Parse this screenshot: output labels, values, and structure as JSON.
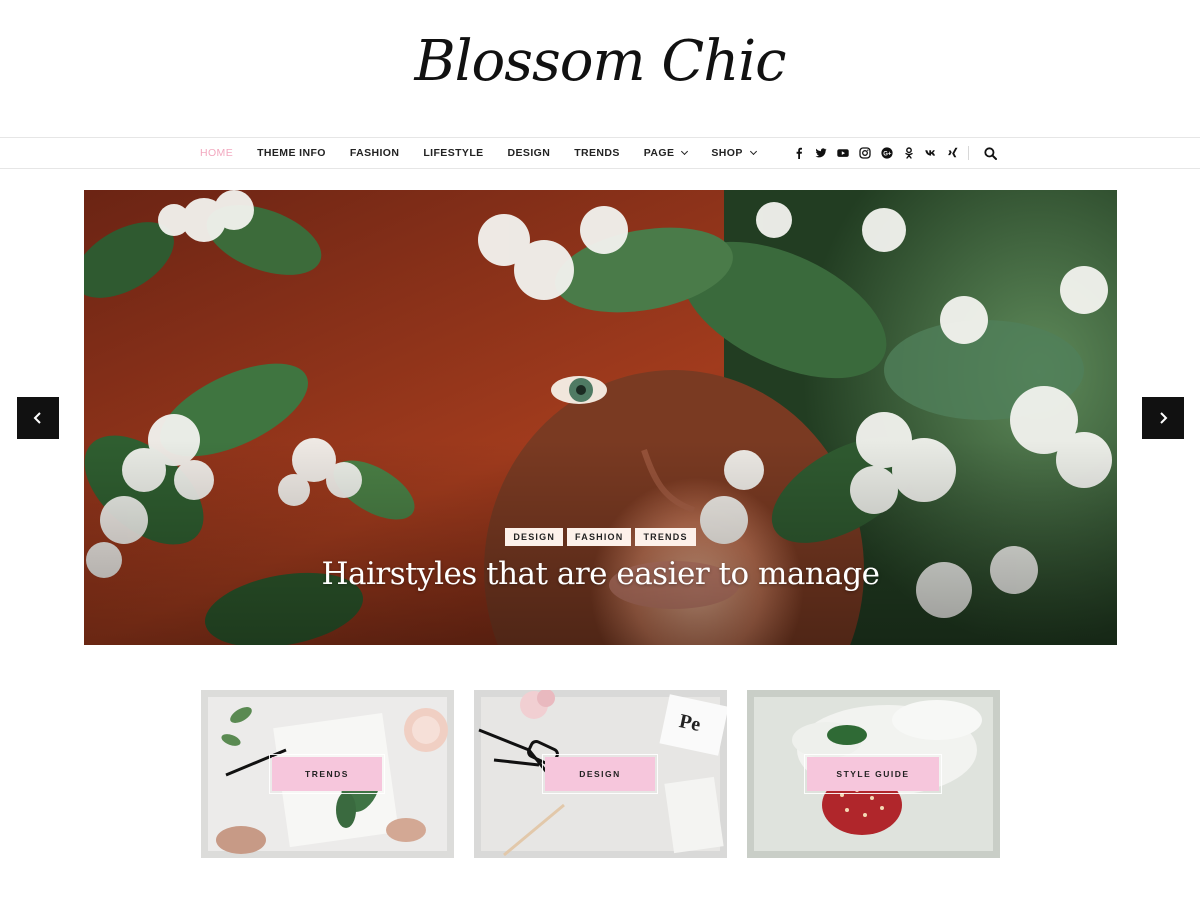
{
  "site": {
    "logo": "Blossom Chic"
  },
  "nav": {
    "items": [
      {
        "label": "HOME",
        "active": true
      },
      {
        "label": "THEME INFO"
      },
      {
        "label": "FASHION"
      },
      {
        "label": "LIFESTYLE"
      },
      {
        "label": "DESIGN"
      },
      {
        "label": "TRENDS"
      },
      {
        "label": "PAGE",
        "dropdown": true
      },
      {
        "label": "SHOP",
        "dropdown": true
      }
    ],
    "social_icons": [
      "facebook-icon",
      "twitter-icon",
      "youtube-icon",
      "instagram-icon",
      "google-plus-icon",
      "odnoklassniki-icon",
      "vk-icon",
      "xing-icon"
    ],
    "search_icon": "search-icon"
  },
  "hero": {
    "categories": [
      "DESIGN",
      "FASHION",
      "TRENDS"
    ],
    "title": "Hairstyles that are easier to manage"
  },
  "promos": [
    {
      "label": "TRENDS"
    },
    {
      "label": "DESIGN"
    },
    {
      "label": "STYLE GUIDE"
    }
  ],
  "colors": {
    "accent_pink": "#f2a8bf",
    "promo_label_bg": "#f6c6dc",
    "tag_bg": "#fdf1ea",
    "arrow_bg": "#111111"
  }
}
